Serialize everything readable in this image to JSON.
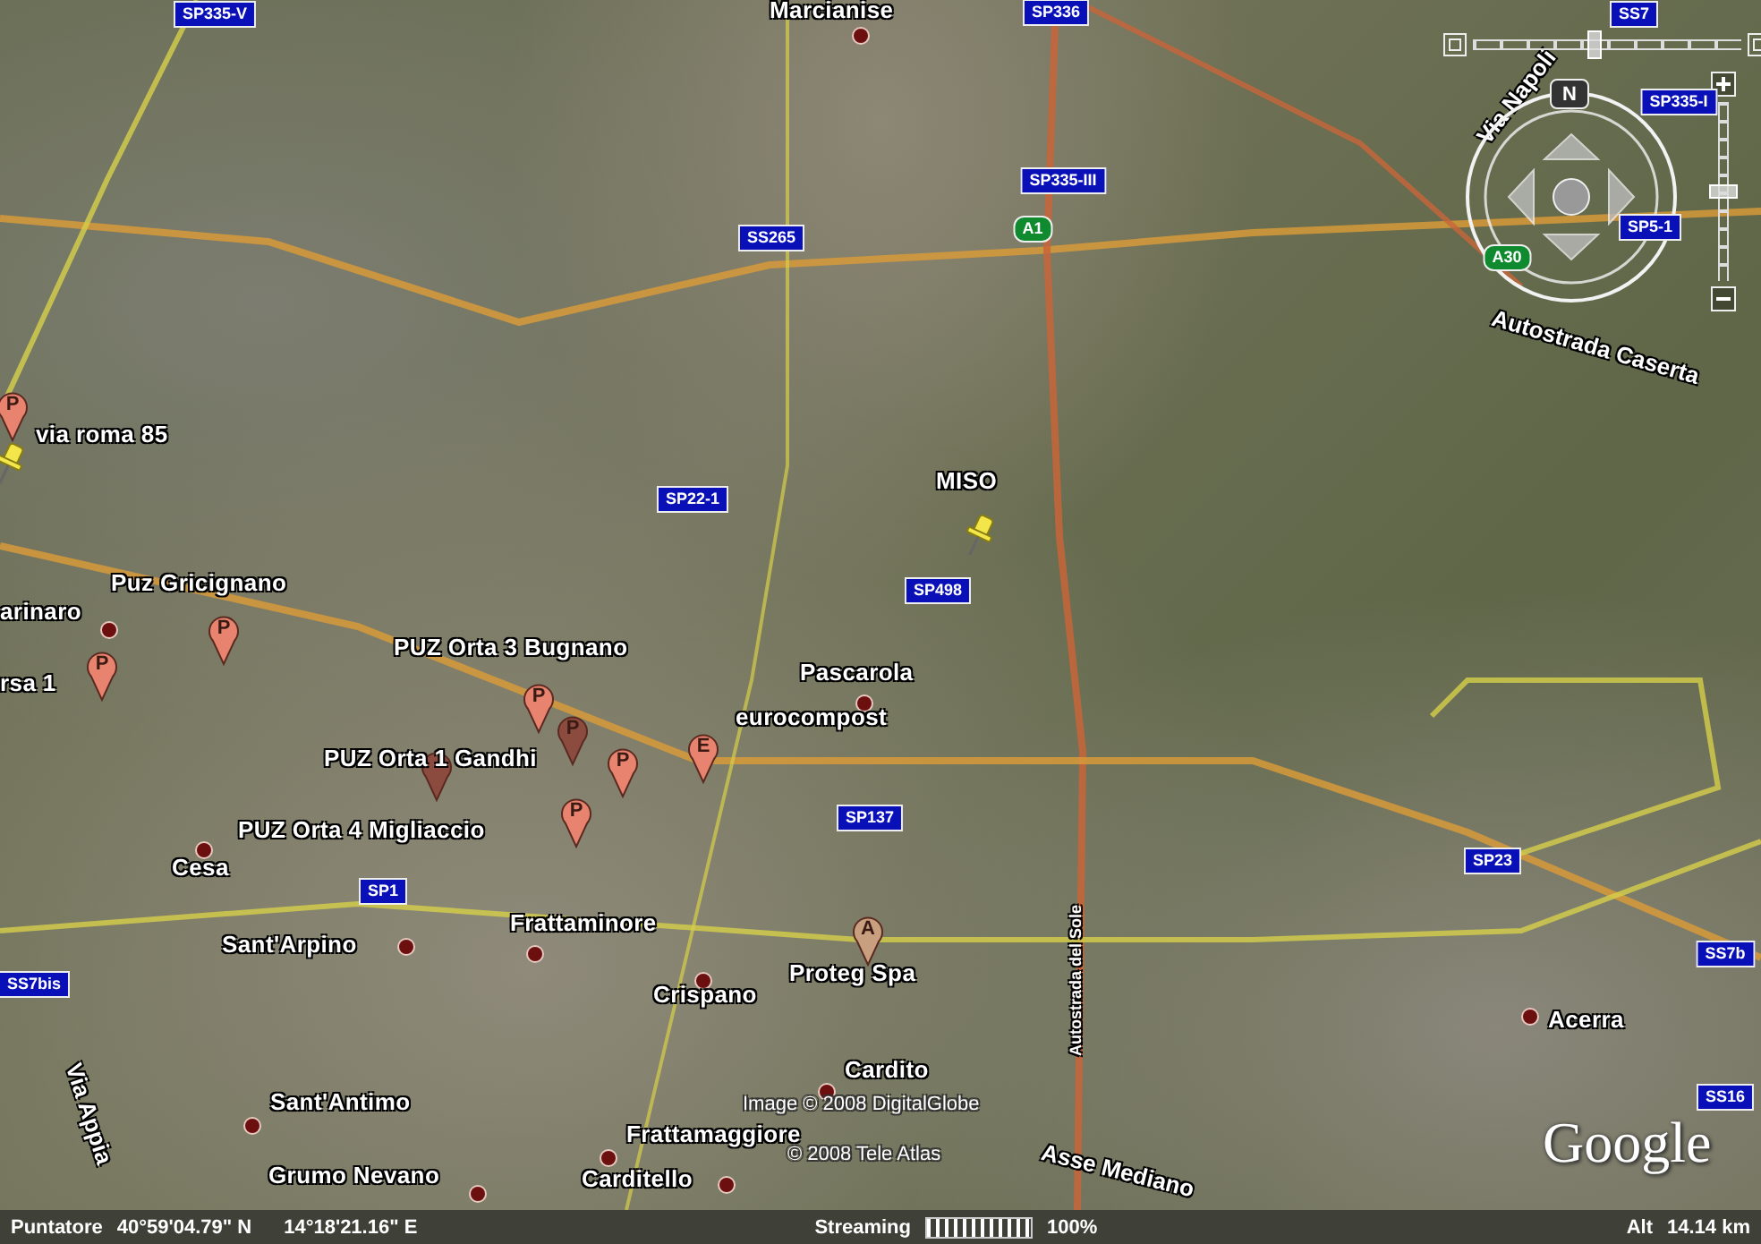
{
  "map": {
    "towns": [
      "Marcianise",
      "Pascarola",
      "Frattaminore",
      "Crispano",
      "Sant'Arpino",
      "Cesa",
      "Cardito",
      "Sant'Antimo",
      "Frattamaggiore",
      "Grumo Nevano",
      "Carditello",
      "Acerra",
      "arinaro"
    ],
    "placemark_labels": [
      "via roma 85",
      "Puz  Gricignano",
      "rsa 1",
      "PUZ Orta 3 Bugnano",
      "PUZ Orta 1 Gandhi",
      "PUZ Orta 4 Migliaccio",
      "eurocompost",
      "Proteg Spa",
      "MISO"
    ],
    "pins": [
      {
        "kind": "balloon",
        "letter": "P",
        "color": "#e8836f"
      },
      {
        "kind": "balloon",
        "letter": "P",
        "color": "#e8836f"
      },
      {
        "kind": "balloon",
        "letter": "P",
        "color": "#e8836f"
      },
      {
        "kind": "balloon",
        "letter": "P",
        "color": "#e8836f"
      },
      {
        "kind": "balloon",
        "letter": "P",
        "color": "#8c4b3f"
      },
      {
        "kind": "balloon",
        "color": "#8c4b3f"
      },
      {
        "kind": "balloon",
        "letter": "P",
        "color": "#e8836f"
      },
      {
        "kind": "balloon",
        "letter": "P",
        "color": "#e8836f"
      },
      {
        "kind": "balloon",
        "letter": "E",
        "color": "#e8836f"
      },
      {
        "kind": "balloon",
        "letter": "A",
        "color": "#c9a07f"
      },
      {
        "kind": "pushpin",
        "color": "#f2e64a"
      },
      {
        "kind": "pushpin",
        "color": "#f2e64a"
      }
    ],
    "road_shields": [
      {
        "text": "SP335-V",
        "kind": "provincial"
      },
      {
        "text": "SP336",
        "kind": "provincial"
      },
      {
        "text": "SP335-III",
        "kind": "provincial"
      },
      {
        "text": "A1",
        "kind": "motorway"
      },
      {
        "text": "SS265",
        "kind": "provincial"
      },
      {
        "text": "SS7",
        "kind": "provincial"
      },
      {
        "text": "SP335-I",
        "kind": "provincial"
      },
      {
        "text": "SP5-1",
        "kind": "provincial"
      },
      {
        "text": "A30",
        "kind": "motorway"
      },
      {
        "text": "SP22-1",
        "kind": "provincial"
      },
      {
        "text": "SP498",
        "kind": "provincial"
      },
      {
        "text": "SP137",
        "kind": "provincial"
      },
      {
        "text": "SP1",
        "kind": "provincial"
      },
      {
        "text": "SP23",
        "kind": "provincial"
      },
      {
        "text": "SS7bis",
        "kind": "provincial"
      },
      {
        "text": "SS7b",
        "kind": "provincial"
      },
      {
        "text": "SS16",
        "kind": "provincial"
      }
    ],
    "road_names": [
      "Via Napoli",
      "Autostrada Caserta",
      "Via Appia",
      "Autostrada del Sole",
      "Asse Mediano"
    ],
    "attribution": [
      "Image © 2008 DigitalGlobe",
      "© 2008 Tele Atlas"
    ],
    "logo": "Google"
  },
  "navigation": {
    "north_button": "N",
    "tilt_slider": {
      "level": 0.45
    },
    "zoom_slider": {
      "level": 0.5
    }
  },
  "status_bar": {
    "pointer_label": "Puntatore",
    "latitude": "40°59'04.79\" N",
    "longitude": "14°18'21.16\" E",
    "streaming_label": "Streaming",
    "streaming": {
      "level": 1.0
    },
    "streaming_percent": "100%",
    "altitude_label": "Alt",
    "altitude": "14.14 km"
  }
}
